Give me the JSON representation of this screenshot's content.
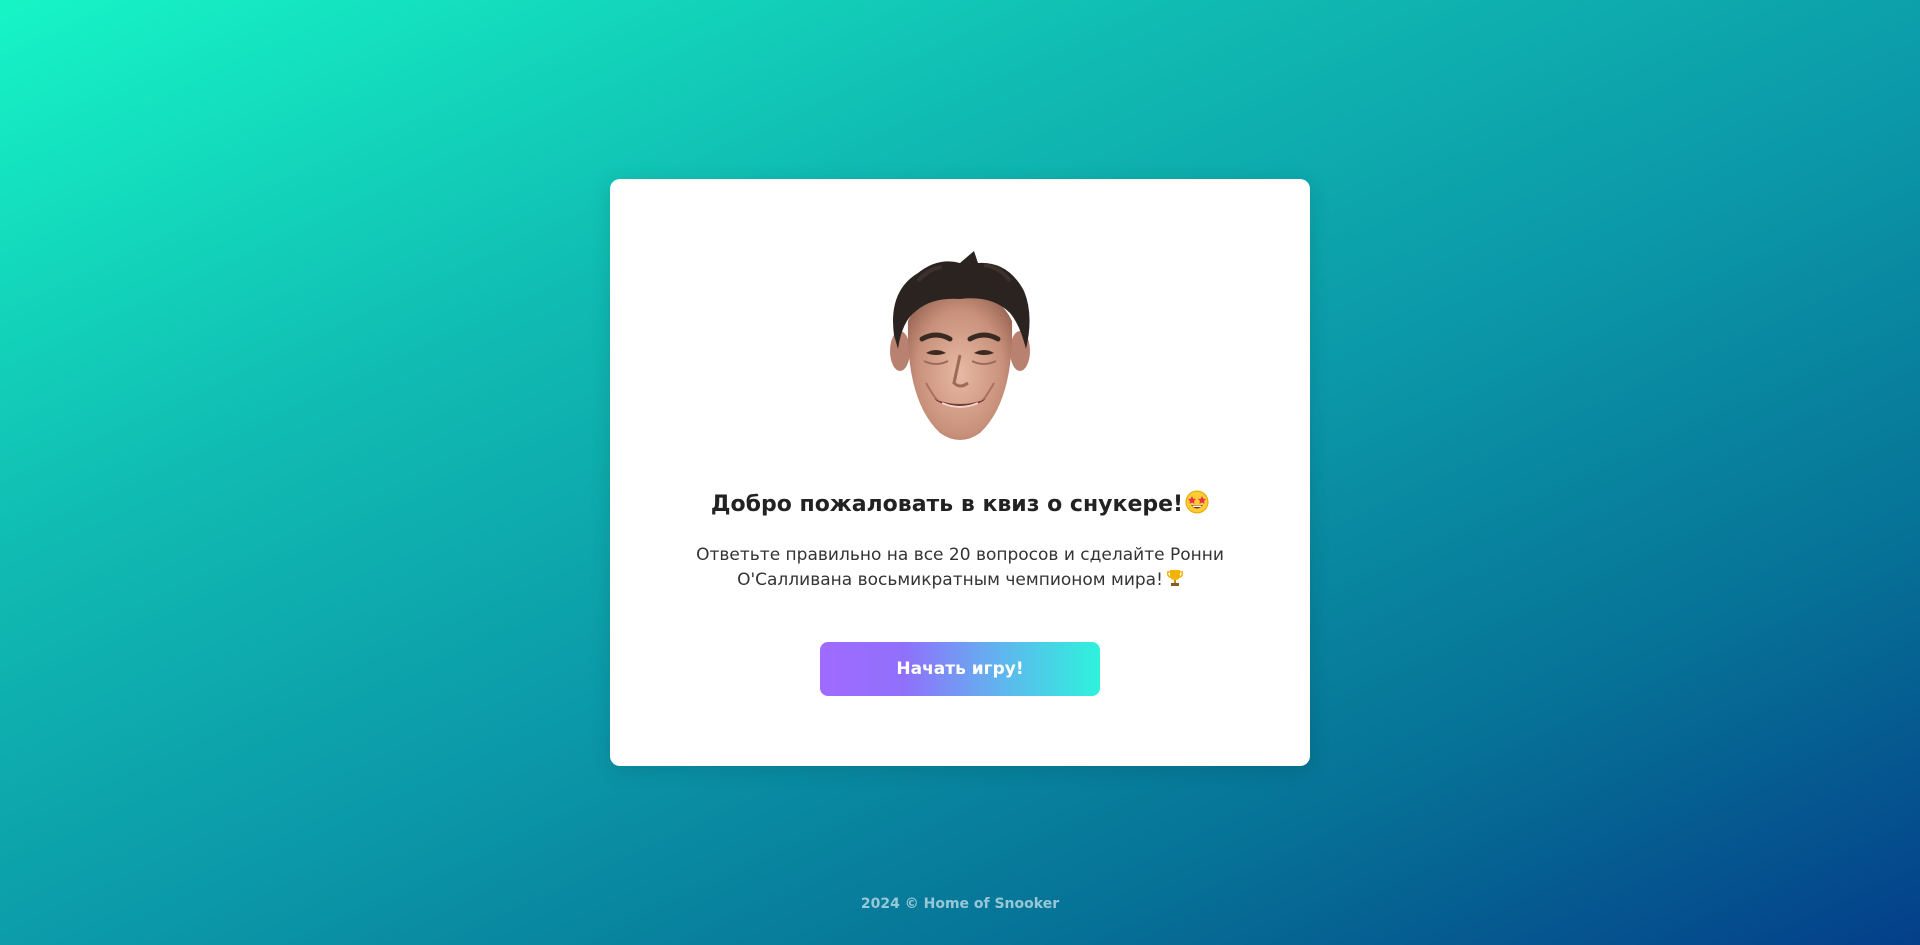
{
  "card": {
    "image_icon": "ronnie-osullivan-face",
    "title": "Добро пожаловать в квиз о снукере!",
    "title_emoji_icon": "star-struck-emoji",
    "description": "Ответьте правильно на все 20 вопросов и сделайте Ронни О'Салливана восьмикратным чемпионом мира!",
    "description_emoji_icon": "trophy-emoji",
    "start_button_label": "Начать игру!"
  },
  "footer": {
    "text": "2024 © Home of Snooker"
  },
  "colors": {
    "background_start": "#16f5c6",
    "background_end": "#043f8a",
    "button_start": "#a06bff",
    "button_end": "#2ef2dc",
    "card": "#ffffff"
  }
}
